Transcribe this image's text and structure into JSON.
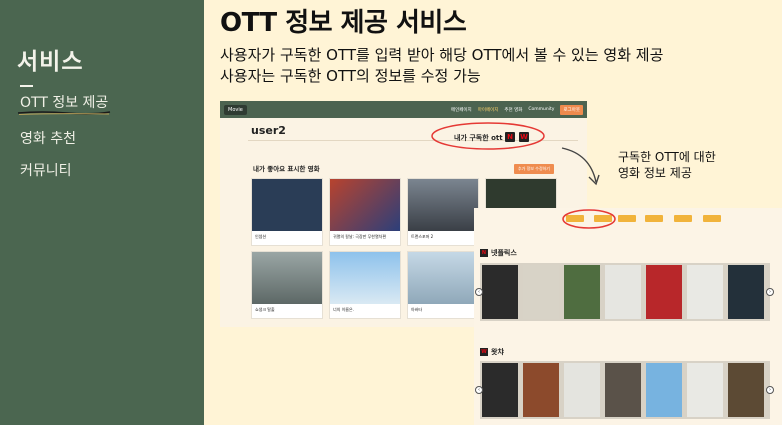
{
  "sidebar": {
    "title": "서비스",
    "items": [
      {
        "label": "OTT 정보 제공"
      },
      {
        "label": "영화 추천"
      },
      {
        "label": "커뮤니티"
      }
    ]
  },
  "main": {
    "title": "OTT 정보 제공 서비스",
    "desc1": "사용자가 구독한 OTT를 입력 받아 해당 OTT에서 볼 수 있는 영화 제공",
    "desc2": "사용자는 구독한 OTT의 정보를 수정 가능"
  },
  "annotation": {
    "line1": "구독한 OTT에 대한",
    "line2": "영화 정보 제공"
  },
  "screenshot1": {
    "logo": "Movie",
    "nav": [
      "메인페이지",
      "마이페이지",
      "추천 영화",
      "Community",
      "로그아웃"
    ],
    "username": "user2",
    "ott_label": "내가 구독한 ott",
    "ott_icons": [
      "N",
      "W"
    ],
    "liked_title": "내가 좋아요 표시한 영화",
    "liked_button": "추가 정보 수정하기",
    "movies": [
      {
        "title": "인셉션",
        "color": "#2a3d56"
      },
      {
        "title": "귀멸의 칼날: 극장판 무한열차편",
        "color": "#b8432e"
      },
      {
        "title": "트랜스포머 2",
        "color": "#4a4f58"
      },
      {
        "title": "",
        "color": "#2f3a2e"
      },
      {
        "title": "쇼생크 탈출",
        "color": "#6e7b7a"
      },
      {
        "title": "너의 이름은.",
        "color": "#7fb1dd"
      },
      {
        "title": "아바타",
        "color": "#a9c6dd"
      }
    ]
  },
  "screenshot2": {
    "ott_buttons": [
      "",
      "",
      "",
      "",
      "",
      ""
    ],
    "sections": [
      {
        "name": "넷플릭스",
        "icon": "N",
        "posters": [
          "#2b2b2b",
          "#d8d3c7",
          "#4f6d40",
          "#e6e6e1",
          "#b8272a",
          "#e9e9e4",
          "#23303a"
        ]
      },
      {
        "name": "왓챠",
        "icon": "W",
        "posters": [
          "#2b2b2b",
          "#8c4a2c",
          "#e4e4df",
          "#5a5249",
          "#77b3e0",
          "#e9e9e4",
          "#5c4a34"
        ]
      }
    ]
  },
  "colors": {
    "sidebar": "#4b6650",
    "background": "#fff4d6",
    "accent": "#ef8c4f",
    "highlight_ring": "#e53935"
  }
}
